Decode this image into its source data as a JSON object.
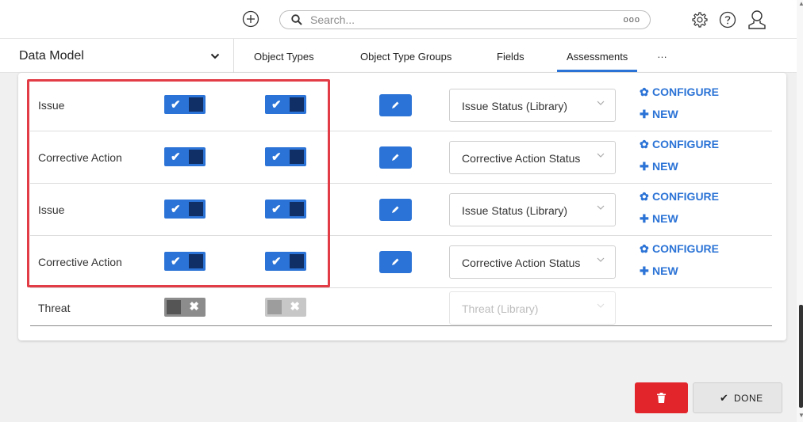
{
  "header": {
    "search_placeholder": "Search...",
    "search_more": "ooo"
  },
  "nav": {
    "title": "Data Model",
    "tabs": [
      {
        "label": "Object Types"
      },
      {
        "label": "Object Type Groups"
      },
      {
        "label": "Fields"
      },
      {
        "label": "Assessments",
        "active": true
      }
    ],
    "more": "…"
  },
  "rows": [
    {
      "name": "Issue",
      "toggle1": "on",
      "toggle2": "on",
      "status": "Issue Status (Library)",
      "configure": "CONFIGURE",
      "new": "NEW"
    },
    {
      "name": "Corrective Action",
      "toggle1": "on",
      "toggle2": "on",
      "status": "Corrective Action Status",
      "configure": "CONFIGURE",
      "new": "NEW"
    },
    {
      "name": "Issue",
      "toggle1": "on",
      "toggle2": "on",
      "status": "Issue Status (Library)",
      "configure": "CONFIGURE",
      "new": "NEW"
    },
    {
      "name": "Corrective Action",
      "toggle1": "on",
      "toggle2": "on",
      "status": "Corrective Action Status",
      "configure": "CONFIGURE",
      "new": "NEW"
    },
    {
      "name": "Threat",
      "toggle1": "off",
      "toggle2": "off",
      "status": "Threat (Library)",
      "disabled": true
    }
  ],
  "footer": {
    "done_label": "DONE"
  },
  "colors": {
    "accent": "#2b73d6",
    "danger": "#e2242b",
    "highlight": "#e23c46"
  }
}
